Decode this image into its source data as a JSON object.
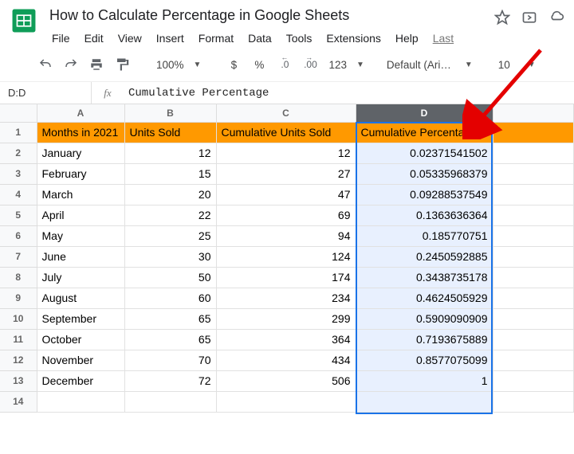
{
  "doc": {
    "title": "How to Calculate Percentage in Google Sheets"
  },
  "menu": {
    "file": "File",
    "edit": "Edit",
    "view": "View",
    "insert": "Insert",
    "format": "Format",
    "data": "Data",
    "tools": "Tools",
    "extensions": "Extensions",
    "help": "Help",
    "last": "Last"
  },
  "toolbar": {
    "zoom": "100%",
    "currency": "$",
    "percent": "%",
    "dec_dec": ".0",
    "dec_inc": ".00",
    "numfmt": "123",
    "font": "Default (Ari…",
    "font_size": "10"
  },
  "fx": {
    "name_box": "D:D",
    "label": "fx",
    "formula": "Cumulative Percentage"
  },
  "columns": {
    "A": "A",
    "B": "B",
    "C": "C",
    "D": "D"
  },
  "headers": {
    "A": "Months in 2021",
    "B": "Units Sold",
    "C": "Cumulative Units Sold",
    "D": "Cumulative Percentage"
  },
  "rows": [
    {
      "n": "1"
    },
    {
      "n": "2",
      "A": "January",
      "B": "12",
      "C": "12",
      "D": "0.02371541502"
    },
    {
      "n": "3",
      "A": "February",
      "B": "15",
      "C": "27",
      "D": "0.05335968379"
    },
    {
      "n": "4",
      "A": "March",
      "B": "20",
      "C": "47",
      "D": "0.09288537549"
    },
    {
      "n": "5",
      "A": "April",
      "B": "22",
      "C": "69",
      "D": "0.1363636364"
    },
    {
      "n": "6",
      "A": "May",
      "B": "25",
      "C": "94",
      "D": "0.185770751"
    },
    {
      "n": "7",
      "A": "June",
      "B": "30",
      "C": "124",
      "D": "0.2450592885"
    },
    {
      "n": "8",
      "A": "July",
      "B": "50",
      "C": "174",
      "D": "0.3438735178"
    },
    {
      "n": "9",
      "A": "August",
      "B": "60",
      "C": "234",
      "D": "0.4624505929"
    },
    {
      "n": "10",
      "A": "September",
      "B": "65",
      "C": "299",
      "D": "0.5909090909"
    },
    {
      "n": "11",
      "A": "October",
      "B": "65",
      "C": "364",
      "D": "0.7193675889"
    },
    {
      "n": "12",
      "A": "November",
      "B": "70",
      "C": "434",
      "D": "0.8577075099"
    },
    {
      "n": "13",
      "A": "December",
      "B": "72",
      "C": "506",
      "D": "1"
    },
    {
      "n": "14"
    }
  ],
  "selected_column": "D"
}
